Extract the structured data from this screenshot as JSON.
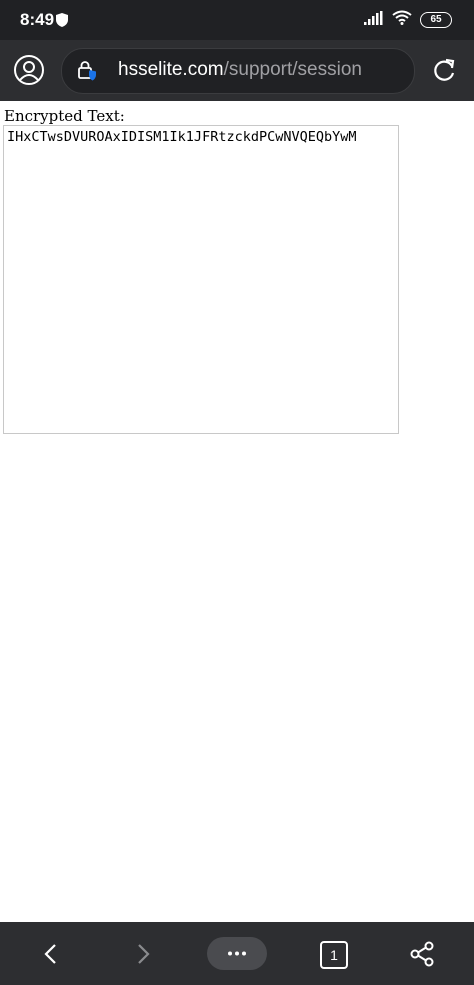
{
  "status_bar": {
    "time": "8:49",
    "battery": "65"
  },
  "address_bar": {
    "host": "hsselite.com",
    "path": "/support/session"
  },
  "page": {
    "label": "Encrypted Text:",
    "encrypted_text": "IHxCTwsDVUROAxIDISM1Ik1JFRtzckdPCwNVQEQbYwM"
  },
  "bottom_bar": {
    "tab_count": "1"
  },
  "colors": {
    "chrome_dark": "#202124",
    "toolbar": "#2d2e31",
    "secure_badge": "#1a73e8"
  }
}
